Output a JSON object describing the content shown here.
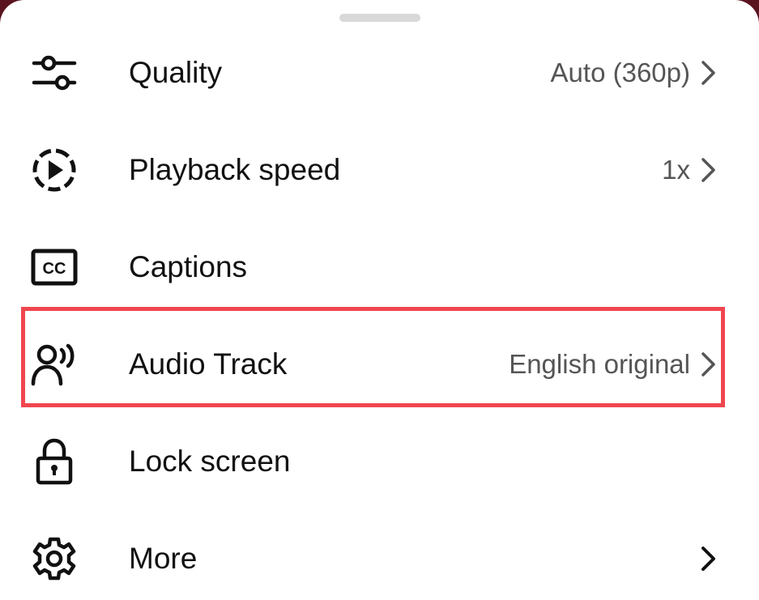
{
  "menu": {
    "items": [
      {
        "id": "quality",
        "label": "Quality",
        "value": "Auto (360p)",
        "icon": "sliders-icon",
        "chevron": true
      },
      {
        "id": "playback-speed",
        "label": "Playback speed",
        "value": "1x",
        "icon": "playback-speed-icon",
        "chevron": true
      },
      {
        "id": "captions",
        "label": "Captions",
        "value": "",
        "icon": "cc-icon",
        "chevron": false
      },
      {
        "id": "audio-track",
        "label": "Audio Track",
        "value": "English original",
        "icon": "audio-track-icon",
        "chevron": true
      },
      {
        "id": "lock-screen",
        "label": "Lock screen",
        "value": "",
        "icon": "lock-icon",
        "chevron": false
      },
      {
        "id": "more",
        "label": "More",
        "value": "",
        "icon": "gear-icon",
        "chevron": true
      }
    ],
    "highlighted_item": "audio-track"
  },
  "colors": {
    "highlight": "#f0464f",
    "label": "#111111",
    "value": "#555555",
    "handle": "#d9d9d9",
    "backdrop": "#5a1420"
  }
}
